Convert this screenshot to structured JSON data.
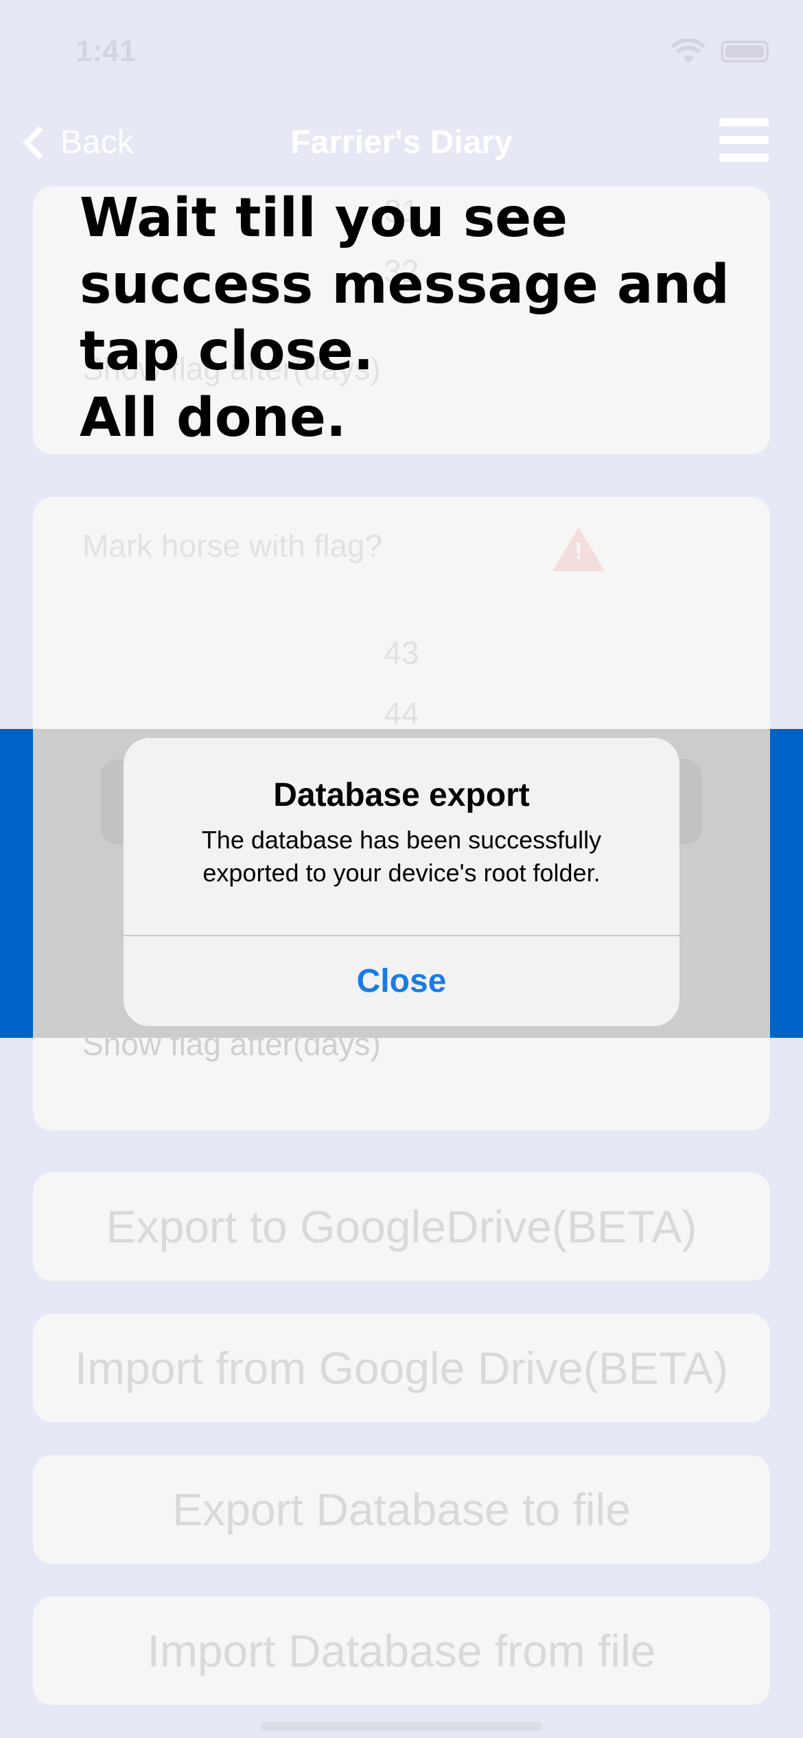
{
  "status_bar": {
    "time": "1:41",
    "wifi_icon": "wifi-icon",
    "battery_icon": "battery-icon"
  },
  "nav": {
    "back_label": "Back",
    "title": "Farrier's Diary",
    "menu_icon": "hamburger-menu-icon"
  },
  "top_card": {
    "picker_values": [
      "31",
      "32"
    ],
    "show_flag_label": "Show flag after(days)"
  },
  "instructions": {
    "line1": "Wait till you see",
    "line2": "success message and",
    "line3": "tap close.",
    "line4": "All done."
  },
  "mid_card": {
    "mark_flag_label": "Mark horse with flag?",
    "warning_icon": "warning-triangle-icon",
    "picker_values": [
      "43",
      "44"
    ],
    "show_flag_label": "Show flag after(days)"
  },
  "buttons": {
    "export_drive": "Export to GoogleDrive(BETA)",
    "import_drive": "Import from Google Drive(BETA)",
    "export_file": "Export Database to file",
    "import_file": "Import Database from file"
  },
  "alert": {
    "title": "Database export",
    "message": "The database has been successfully exported to your device's root folder.",
    "close_label": "Close"
  },
  "colors": {
    "background": "#e6e8f5",
    "band_blue": "#0063c7",
    "alert_button": "#1a7be6"
  }
}
